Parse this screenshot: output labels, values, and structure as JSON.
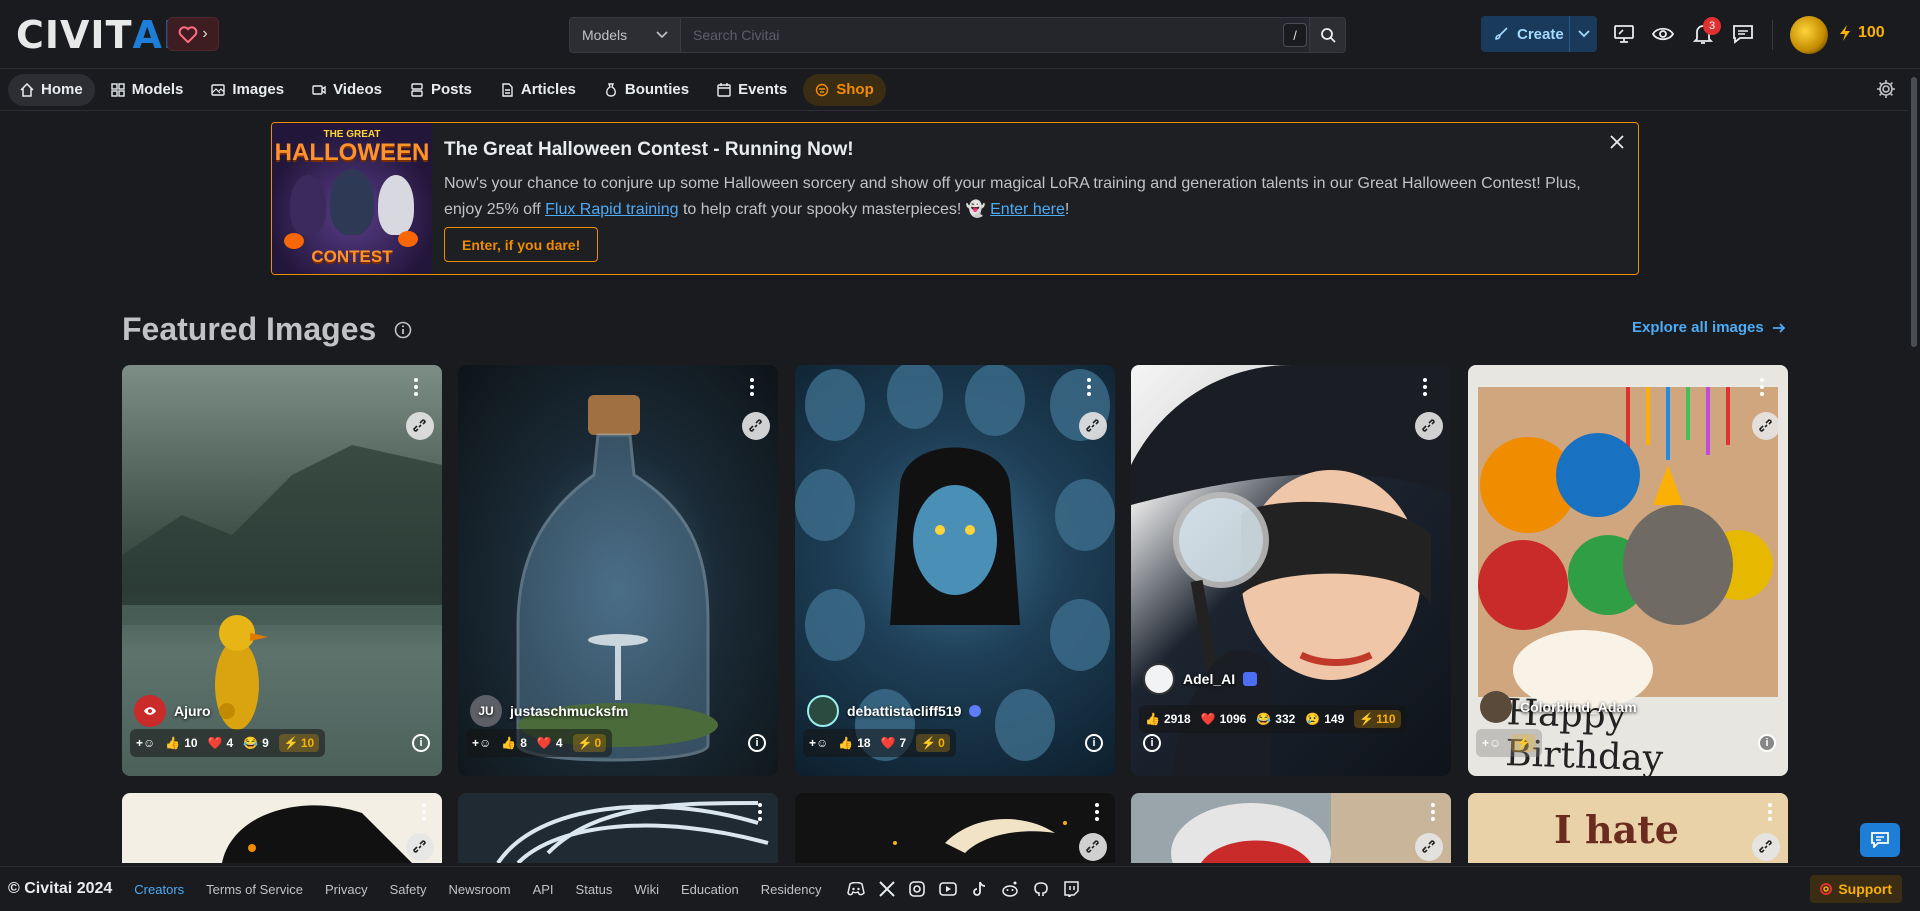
{
  "header": {
    "logo_part1": "CIVIT",
    "logo_part2": "AI",
    "search_scope": "Models",
    "search_placeholder": "Search Civitai",
    "search_shortcut": "/",
    "create_label": "Create",
    "notification_count": "3",
    "buzz_balance": "100"
  },
  "nav": {
    "items": [
      {
        "label": "Home",
        "icon": "home-icon"
      },
      {
        "label": "Models",
        "icon": "grid-icon"
      },
      {
        "label": "Images",
        "icon": "photo-icon"
      },
      {
        "label": "Videos",
        "icon": "video-icon"
      },
      {
        "label": "Posts",
        "icon": "posts-icon"
      },
      {
        "label": "Articles",
        "icon": "article-icon"
      },
      {
        "label": "Bounties",
        "icon": "moneybag-icon"
      },
      {
        "label": "Events",
        "icon": "calendar-icon"
      },
      {
        "label": "Shop",
        "icon": "shop-icon"
      }
    ]
  },
  "banner": {
    "image_top": "THE GREAT",
    "image_mid": "HALLOWEEN",
    "image_bottom": "CONTEST",
    "title": "The Great Halloween Contest - Running Now!",
    "text_1": "Now's your chance to conjure up some Halloween sorcery and show off your magical LoRA training and generation talents in our Great Halloween Contest! Plus, enjoy 25% off ",
    "link_1": "Flux Rapid training",
    "text_2": " to help craft your spooky masterpieces! 👻 ",
    "link_2": "Enter here",
    "text_3": "!",
    "cta": "Enter, if you dare!"
  },
  "featured": {
    "title": "Featured Images",
    "explore_label": "Explore all images",
    "cards": [
      {
        "author": "Ajuro",
        "likes": "10",
        "hearts": "4",
        "laughs": "9",
        "buzz": "10"
      },
      {
        "author": "justaschmucksfm",
        "avatar_initials": "JU",
        "likes": "8",
        "hearts": "4",
        "buzz": "0"
      },
      {
        "author": "debattistacliff519",
        "likes": "18",
        "hearts": "7",
        "buzz": "0"
      },
      {
        "author": "Adel_AI",
        "likes": "2918",
        "hearts": "1096",
        "laughs": "332",
        "cries": "149",
        "buzz": "110"
      },
      {
        "author": "Colorblind_Adam",
        "overlay_text": "Happy Birthday"
      }
    ],
    "row2_text_5": "I hate"
  },
  "footer": {
    "copyright": "© Civitai 2024",
    "links": [
      "Creators",
      "Terms of Service",
      "Privacy",
      "Safety",
      "Newsroom",
      "API",
      "Status",
      "Wiki",
      "Education",
      "Residency"
    ],
    "support_label": "Support"
  }
}
